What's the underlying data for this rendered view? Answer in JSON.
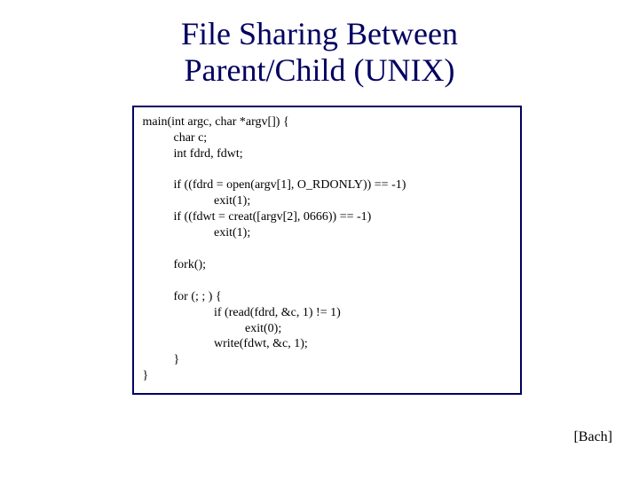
{
  "title_line1": "File Sharing Between",
  "title_line2": "Parent/Child (UNIX)",
  "code": "main(int argc, char *argv[]) {\n          char c;\n          int fdrd, fdwt;\n\n          if ((fdrd = open(argv[1], O_RDONLY)) == -1)\n                       exit(1);\n          if ((fdwt = creat([argv[2], 0666)) == -1)\n                       exit(1);\n\n          fork();\n\n          for (; ; ) {\n                       if (read(fdrd, &c, 1) != 1)\n                                 exit(0);\n                       write(fdwt, &c, 1);\n          }\n}",
  "attribution": "[Bach]"
}
